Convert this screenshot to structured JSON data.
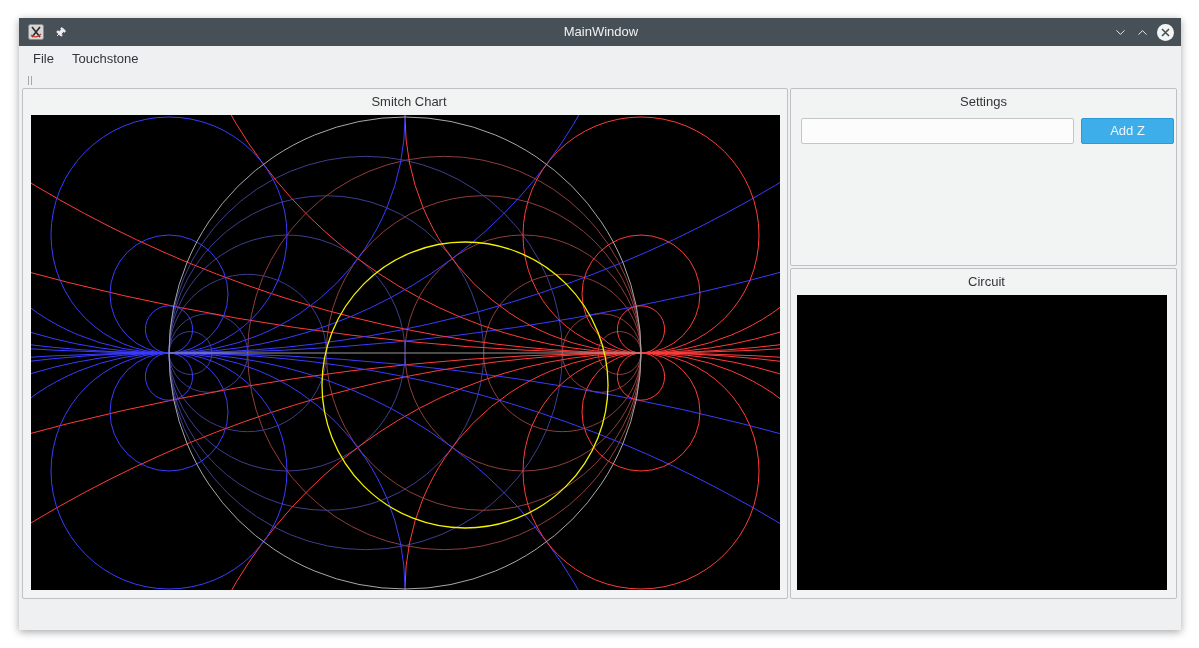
{
  "window": {
    "title": "MainWindow"
  },
  "menu": [
    "File",
    "Touchstone"
  ],
  "smith_chart": {
    "title": "Smitch Chart"
  },
  "settings": {
    "title": "Settings",
    "button": "Add Z"
  },
  "circuit": {
    "title": "Circuit"
  }
}
